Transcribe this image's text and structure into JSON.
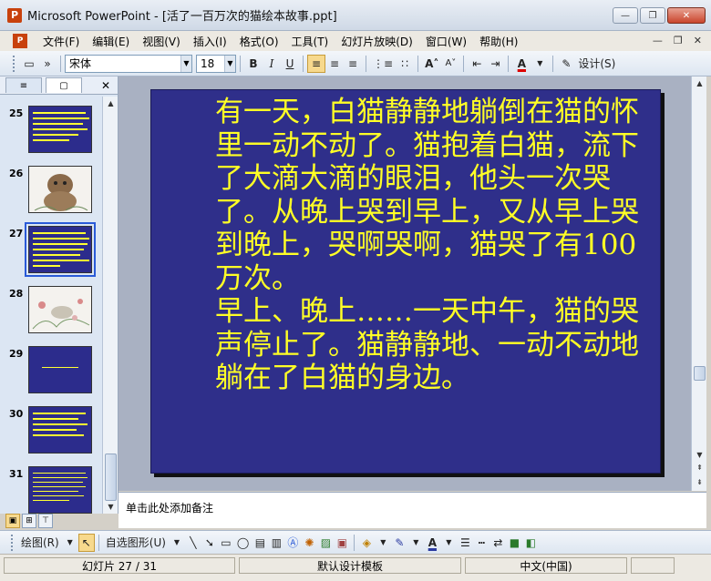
{
  "window": {
    "title": "Microsoft PowerPoint - [活了一百万次的猫绘本故事.ppt]",
    "app_icon": "powerpoint-icon",
    "minimize": "—",
    "restore": "❐",
    "close": "✕"
  },
  "menu": {
    "items": [
      "文件(F)",
      "编辑(E)",
      "视图(V)",
      "插入(I)",
      "格式(O)",
      "工具(T)",
      "幻灯片放映(D)",
      "窗口(W)",
      "帮助(H)"
    ],
    "doc_min": "—",
    "doc_restore": "❐",
    "doc_close": "✕"
  },
  "toolbar": {
    "font_name": "宋体",
    "font_size": "18",
    "bold": "B",
    "italic": "I",
    "underline": "U",
    "font_color_label": "A",
    "design_label": "设计(S)"
  },
  "left_pane": {
    "tab_outline": "≡",
    "tab_slides": "▢",
    "close": "✕",
    "thumbnails": [
      {
        "number": "25",
        "kind": "text"
      },
      {
        "number": "26",
        "kind": "picture"
      },
      {
        "number": "27",
        "kind": "text",
        "selected": true
      },
      {
        "number": "28",
        "kind": "picture"
      },
      {
        "number": "29",
        "kind": "text-short"
      },
      {
        "number": "30",
        "kind": "text"
      },
      {
        "number": "31",
        "kind": "text"
      }
    ]
  },
  "slide": {
    "paragraph1": "有一天，白猫静静地躺倒在猫的怀里一动不动了。猫抱着白猫，流下了大滴大滴的眼泪，他头一次哭了。从晚上哭到早上，又从早上哭到晚上，哭啊哭啊，猫哭了有100万次。",
    "paragraph2": "早上、晚上……一天中午，猫的哭声停止了。猫静静地、一动不动地躺在了白猫的身边。",
    "background_color": "#2f2f8a",
    "text_color": "#ffff26"
  },
  "notes": {
    "placeholder": "单击此处添加备注"
  },
  "drawing_toolbar": {
    "draw_label": "绘图(R)",
    "autoshapes_label": "自选图形(U)"
  },
  "status": {
    "slide_position": "幻灯片 27 / 31",
    "design_template": "默认设计模板",
    "language": "中文(中国)"
  }
}
